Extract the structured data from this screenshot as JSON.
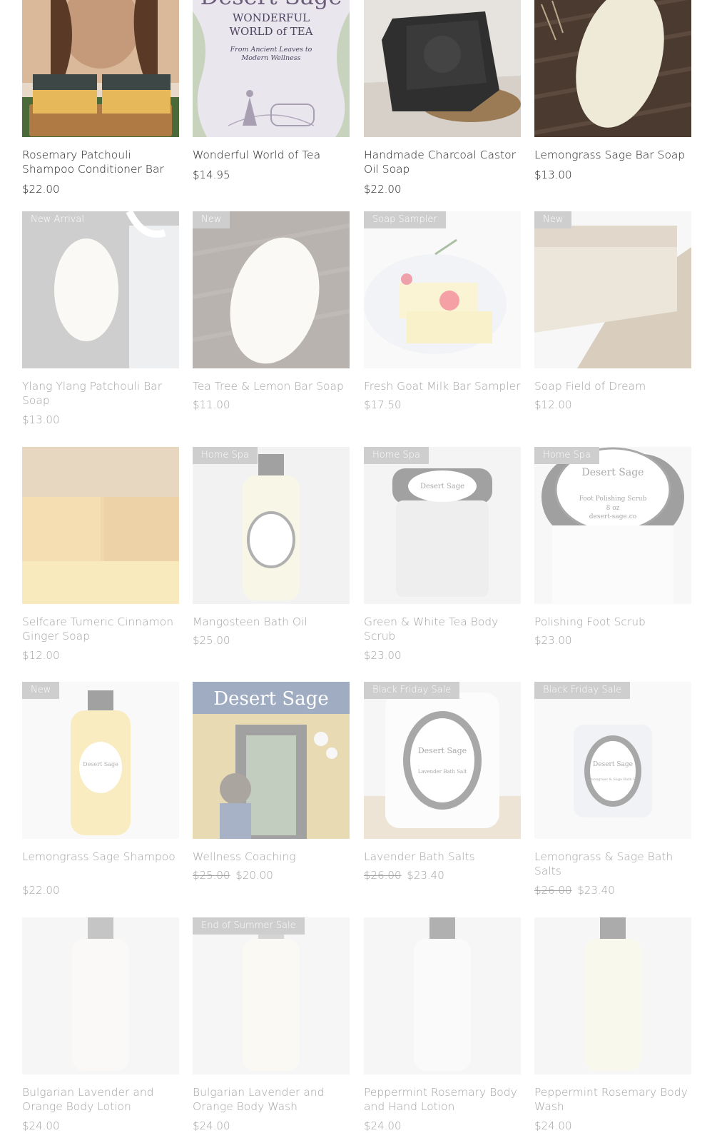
{
  "products": [
    {
      "name": "Rosemary Patchouli Shampoo Conditioner Bar",
      "price": "$22.00",
      "ribbon": "",
      "image": "soap-bars-photo"
    },
    {
      "name": "Wonderful World of Tea",
      "price": "$14.95",
      "ribbon": "",
      "image": "book-cover",
      "book": {
        "title": "Desert Sage",
        "subtitle1": "WONDERFUL",
        "subtitle2": "WORLD of TEA",
        "tagline1": "From Ancient Leaves to",
        "tagline2": "Modern Wellness"
      }
    },
    {
      "name": "Handmade Charcoal Castor Oil Soap",
      "price": "$22.00",
      "ribbon": "",
      "image": "charcoal-soap-photo"
    },
    {
      "name": "Lemongrass Sage Bar Soap",
      "price": "$13.00",
      "ribbon": "",
      "image": "oval-soap-photo"
    },
    {
      "name": "Ylang Ylang Patchouli Bar Soap",
      "price": "$13.00",
      "ribbon": "New Arrival",
      "image": "oval-soap-photo"
    },
    {
      "name": "Tea Tree & Lemon Bar Soap",
      "price": "$11.00",
      "ribbon": "New",
      "image": "oval-soap-photo"
    },
    {
      "name": "Fresh Goat Milk Bar Sampler",
      "price": "$17.50",
      "ribbon": "Soap Sampler",
      "image": "soap-sampler-photo"
    },
    {
      "name": "Soap Field of Dream",
      "price": "$12.00",
      "ribbon": "New",
      "image": "soap-loaf-photo"
    },
    {
      "name": "Selfcare Tumeric Cinnamon Ginger Soap",
      "price": "$12.00",
      "ribbon": "",
      "image": "soap-block-photo"
    },
    {
      "name": "Mangosteen Bath Oil",
      "price": "$25.00",
      "ribbon": "Home Spa",
      "image": "bottle-photo"
    },
    {
      "name": "Green & White Tea Body Scrub",
      "price": "$23.00",
      "ribbon": "Home Spa",
      "image": "jar-photo"
    },
    {
      "name": "Polishing Foot Scrub",
      "price": "$23.00",
      "ribbon": "Home Spa",
      "image": "jar-photo"
    },
    {
      "name": "Lemongrass Sage Shampoo",
      "price": "$22.00",
      "ribbon": "New",
      "image": "yellow-bottle-photo"
    },
    {
      "name": "Wellness Coaching",
      "price": "$20.00",
      "old_price": "$25.00",
      "ribbon": "",
      "image": "storefront-photo",
      "sign_text": "Desert Sage"
    },
    {
      "name": "Lavender Bath Salts",
      "price": "$23.40",
      "old_price": "$26.00",
      "ribbon": "Black Friday Sale",
      "image": "bath-salt-tub-photo"
    },
    {
      "name": "Lemongrass & Sage Bath Salts",
      "price": "$23.40",
      "old_price": "$26.00",
      "ribbon": "Black Friday Sale",
      "image": "bath-salt-jar-photo"
    },
    {
      "name": "Bulgarian Lavender and Orange Body Lotion",
      "price": "$24.00",
      "ribbon": "",
      "image": "blurred-bottle-photo"
    },
    {
      "name": "Bulgarian Lavender and Orange Body Wash",
      "price": "$24.00",
      "ribbon": "End of Summer Sale",
      "image": "blurred-bottle-photo"
    },
    {
      "name": "Peppermint Rosemary Body and Hand Lotion",
      "price": "$24.00",
      "ribbon": "",
      "image": "blurred-bottle-photo"
    },
    {
      "name": "Peppermint Rosemary Body Wash",
      "price": "$24.00",
      "ribbon": "",
      "image": "blurred-bottle-photo"
    }
  ],
  "label_text": {
    "jar_brand": "Desert Sage",
    "foot_scrub": "Foot Polishing Scrub",
    "foot_scrub_size": "8 oz",
    "site": "desert-sage.co",
    "lavender_salt": "Lavender Bath Salt",
    "lemongrass_salt": "Lemongrass & Sage Bath Salt",
    "shampoo": "Lemongrass Sage Shampoo"
  },
  "colors": {
    "ribbon_bg": "#8c8c8c",
    "text": "#222222",
    "page_bg": "#ffffff"
  }
}
